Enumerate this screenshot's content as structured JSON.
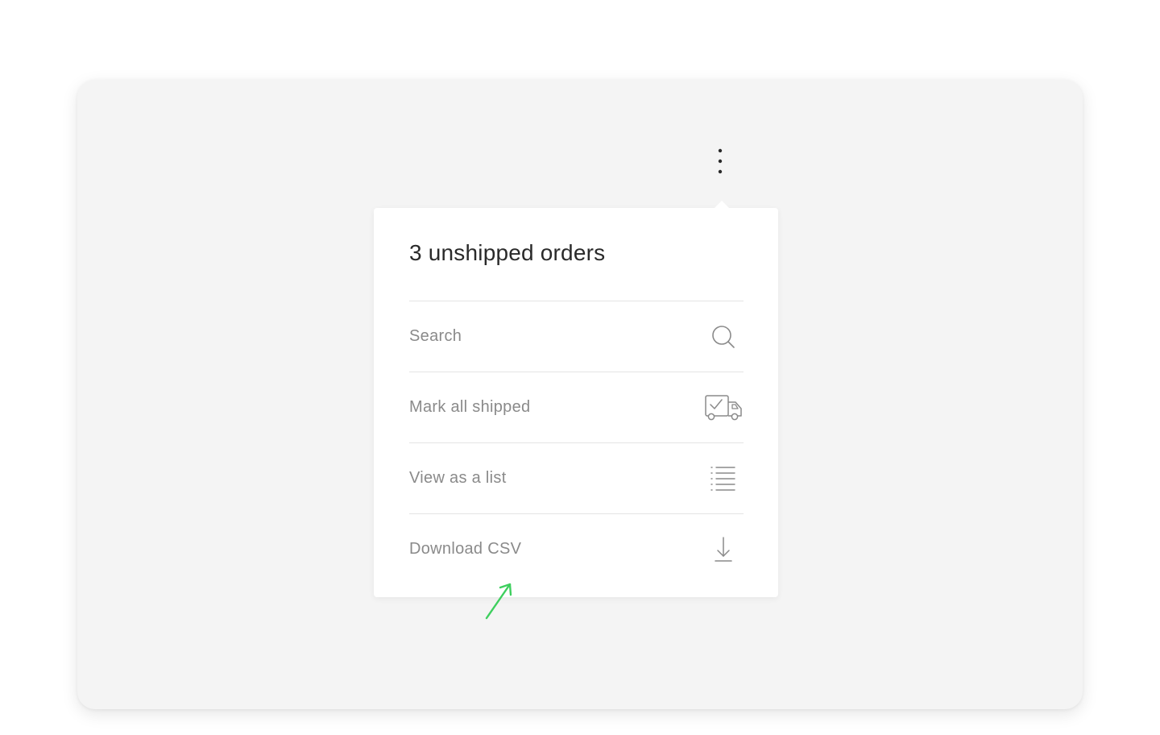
{
  "popover": {
    "title": "3 unshipped orders",
    "items": [
      {
        "label": "Search",
        "icon": "search-icon"
      },
      {
        "label": "Mark all shipped",
        "icon": "truck-check-icon"
      },
      {
        "label": "View as a list",
        "icon": "list-icon"
      },
      {
        "label": "Download CSV",
        "icon": "download-icon"
      }
    ]
  },
  "icons": {
    "kebab": "kebab-menu-icon",
    "annotation": "arrow-annotation-icon"
  },
  "colors": {
    "stage_background": "#f4f4f4",
    "popover_background": "#ffffff",
    "title_text": "#2a2a2a",
    "item_text": "#8a8a8a",
    "icon_stroke": "#8a8a8a",
    "divider": "#e4e4e4",
    "annotation": "#3ecf5e"
  }
}
